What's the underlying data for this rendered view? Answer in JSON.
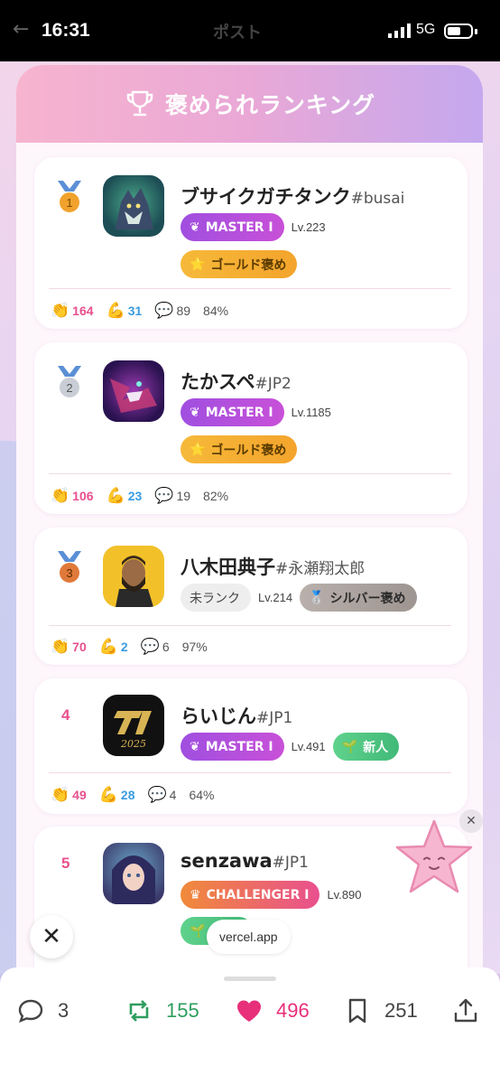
{
  "status_bar": {
    "time": "16:31",
    "network": "5G",
    "blurred_title": "ポスト"
  },
  "panel": {
    "title": "褒められランキング"
  },
  "entries": [
    {
      "rank": "1",
      "name": "ブサイクガチタンク",
      "tag": "#busai",
      "rank_badge": "MASTER I",
      "level": "Lv.223",
      "praise_badge": "ゴールド褒め",
      "stats": {
        "claps": "164",
        "strength": "31",
        "comments": "89",
        "percent": "84%"
      }
    },
    {
      "rank": "2",
      "name": "たかスペ",
      "tag": "#JP2",
      "rank_badge": "MASTER I",
      "level": "Lv.1185",
      "praise_badge": "ゴールド褒め",
      "stats": {
        "claps": "106",
        "strength": "23",
        "comments": "19",
        "percent": "82%"
      }
    },
    {
      "rank": "3",
      "name": "八木田典子",
      "tag": "#永瀬翔太郎",
      "rank_badge": "未ランク",
      "level": "Lv.214",
      "praise_badge": "シルバー褒め",
      "stats": {
        "claps": "70",
        "strength": "2",
        "comments": "6",
        "percent": "97%"
      }
    },
    {
      "rank": "4",
      "name": "らいじん",
      "tag": "#JP1",
      "rank_badge": "MASTER I",
      "level": "Lv.491",
      "praise_badge": "新人",
      "stats": {
        "claps": "49",
        "strength": "28",
        "comments": "4",
        "percent": "64%"
      }
    },
    {
      "rank": "5",
      "name": "senzawa",
      "tag": "#JP1",
      "rank_badge": "CHALLENGER I",
      "level": "Lv.890",
      "praise_badge": "",
      "stats": {}
    }
  ],
  "overlay": {
    "url_pill": "vercel.app"
  },
  "actions": {
    "replies": "3",
    "reposts": "155",
    "likes": "496",
    "bookmarks": "251"
  },
  "colors": {
    "like": "#e8307a",
    "repost": "#2e9e5e",
    "accent_pink": "#e8508e"
  }
}
